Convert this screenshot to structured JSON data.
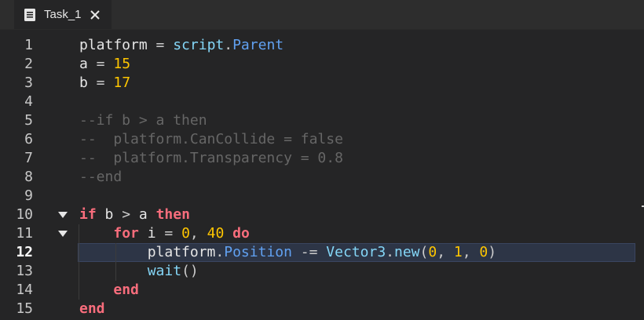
{
  "tab": {
    "label": "Task_1",
    "icon": "document-icon",
    "close": "close-icon"
  },
  "editor": {
    "active_line": 12,
    "folded_lines": [
      10,
      11
    ],
    "line_numbers": [
      "1",
      "2",
      "3",
      "4",
      "5",
      "6",
      "7",
      "8",
      "9",
      "10",
      "11",
      "12",
      "13",
      "14",
      "15"
    ],
    "lines": [
      [
        [
          "id",
          "platform"
        ],
        [
          "op",
          " = "
        ],
        [
          "builtin",
          "script"
        ],
        [
          "op",
          "."
        ],
        [
          "prop",
          "Parent"
        ]
      ],
      [
        [
          "id",
          "a"
        ],
        [
          "op",
          " = "
        ],
        [
          "num",
          "15"
        ]
      ],
      [
        [
          "id",
          "b"
        ],
        [
          "op",
          " = "
        ],
        [
          "num",
          "17"
        ]
      ],
      [],
      [
        [
          "cmt",
          "--if b > a then"
        ]
      ],
      [
        [
          "cmt",
          "--  platform.CanCollide = false"
        ]
      ],
      [
        [
          "cmt",
          "--  platform.Transparency = 0.8"
        ]
      ],
      [
        [
          "cmt",
          "--end"
        ]
      ],
      [],
      [
        [
          "kw",
          "if"
        ],
        [
          "id",
          " b "
        ],
        [
          "op",
          ">"
        ],
        [
          "id",
          " a "
        ],
        [
          "kw",
          "then"
        ]
      ],
      [
        [
          "id",
          "    "
        ],
        [
          "kw",
          "for"
        ],
        [
          "id",
          " i "
        ],
        [
          "op",
          "="
        ],
        [
          "id",
          " "
        ],
        [
          "num",
          "0"
        ],
        [
          "op",
          ", "
        ],
        [
          "num",
          "40"
        ],
        [
          "id",
          " "
        ],
        [
          "kw",
          "do"
        ]
      ],
      [
        [
          "id",
          "        platform"
        ],
        [
          "op",
          "."
        ],
        [
          "prop",
          "Position"
        ],
        [
          "op",
          " -= "
        ],
        [
          "builtin",
          "Vector3"
        ],
        [
          "op",
          "."
        ],
        [
          "builtin",
          "new"
        ],
        [
          "op",
          "("
        ],
        [
          "num",
          "0"
        ],
        [
          "op",
          ", "
        ],
        [
          "num",
          "1"
        ],
        [
          "op",
          ", "
        ],
        [
          "num",
          "0"
        ],
        [
          "op",
          ")"
        ]
      ],
      [
        [
          "id",
          "        "
        ],
        [
          "builtin",
          "wait"
        ],
        [
          "op",
          "()"
        ]
      ],
      [
        [
          "id",
          "    "
        ],
        [
          "kw",
          "end"
        ]
      ],
      [
        [
          "kw",
          "end"
        ]
      ]
    ]
  },
  "colors": {
    "background": "#252526",
    "tabbar": "#2d2d2d",
    "keyword": "#f86d7c",
    "number": "#ffc600",
    "property": "#61a1f1",
    "builtin": "#84d6f7",
    "comment": "#666666",
    "active_line": "#2d3546"
  }
}
